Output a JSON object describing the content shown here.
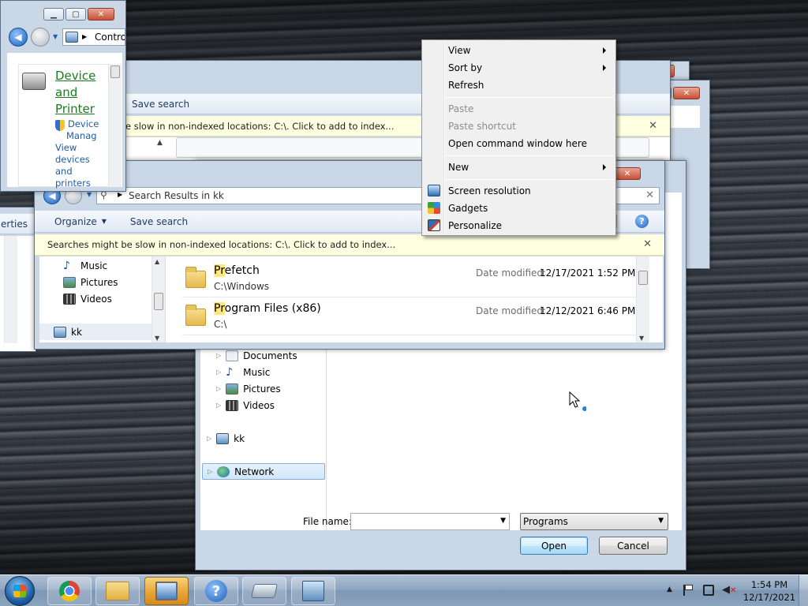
{
  "colors": {
    "accent_blue": "#3c7fb1",
    "infobar_bg": "#ffffe1",
    "taskbar_active": "#e7a537",
    "link_green": "#1a7c1a",
    "search_highlight": "#ffe97a"
  },
  "control_panel_window": {
    "address_text": "Contro",
    "device_link": [
      "Device",
      "and",
      "Printer"
    ],
    "device_manager": [
      "Device",
      "Manag"
    ],
    "view_link": [
      "View",
      "devices",
      "and",
      "printers"
    ]
  },
  "back_window": {
    "save_search": "Save search",
    "info_text": "e slow in non-indexed locations: C:\\. Click to add to index..."
  },
  "left_cut_text": "erties",
  "search_window": {
    "address": "Search Results in kk",
    "toolbar": {
      "organize": "Organize",
      "save_search": "Save search"
    },
    "info_text": "Searches might be slow in non-indexed locations: C:\\. Click to add to index...",
    "nav_items": [
      {
        "label": "Music",
        "icon": "music-icon"
      },
      {
        "label": "Pictures",
        "icon": "pictures-icon"
      },
      {
        "label": "Videos",
        "icon": "videos-icon"
      },
      {
        "label": "kk",
        "icon": "computer-icon"
      }
    ],
    "results": [
      {
        "name_match": "Pr",
        "name_rest": "efetch",
        "path": "C:\\Windows",
        "date_label": "Date modified:",
        "date": "12/17/2021 1:52 PM"
      },
      {
        "name_match": "Pr",
        "name_rest": "ogram Files (x86)",
        "path": "C:\\",
        "date_label": "Date modified:",
        "date": "12/12/2021 6:46 PM"
      }
    ]
  },
  "open_dialog": {
    "nav_items": [
      {
        "label": "Documents",
        "icon": "documents-icon"
      },
      {
        "label": "Music",
        "icon": "music-icon"
      },
      {
        "label": "Pictures",
        "icon": "pictures-icon"
      },
      {
        "label": "Videos",
        "icon": "videos-icon"
      }
    ],
    "computer": "kk",
    "network": "Network",
    "file_name_label": "File name:",
    "file_name_value": "",
    "file_type": "Programs",
    "open_button": "Open",
    "cancel_button": "Cancel"
  },
  "context_menu": {
    "items": [
      {
        "label": "View",
        "submenu": true,
        "disabled": false
      },
      {
        "label": "Sort by",
        "submenu": true,
        "disabled": false
      },
      {
        "label": "Refresh",
        "submenu": false,
        "disabled": false
      },
      {
        "label": "Paste",
        "submenu": false,
        "disabled": true
      },
      {
        "label": "Paste shortcut",
        "submenu": false,
        "disabled": true
      },
      {
        "label": "Open command window here",
        "submenu": false,
        "disabled": false
      },
      {
        "label": "New",
        "submenu": true,
        "disabled": false
      },
      {
        "label": "Screen resolution",
        "icon": "screen-resolution-icon",
        "submenu": false,
        "disabled": false
      },
      {
        "label": "Gadgets",
        "icon": "gadgets-icon",
        "submenu": false,
        "disabled": false
      },
      {
        "label": "Personalize",
        "icon": "personalize-icon",
        "submenu": false,
        "disabled": false
      }
    ]
  },
  "taskbar": {
    "apps": [
      {
        "name": "chrome-icon"
      },
      {
        "name": "explorer-icon"
      },
      {
        "name": "remote-desktop-icon",
        "active": true
      },
      {
        "name": "help-icon"
      },
      {
        "name": "removable-drive-icon"
      },
      {
        "name": "control-panel-icon"
      }
    ],
    "clock_time": "1:54 PM",
    "clock_date": "12/17/2021"
  }
}
